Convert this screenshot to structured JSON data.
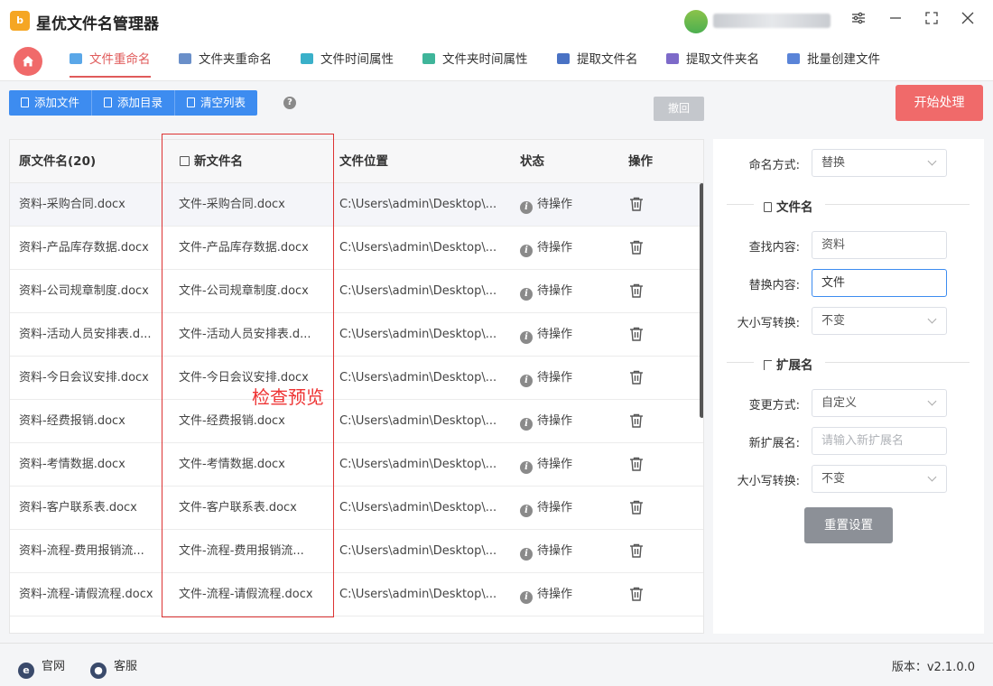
{
  "app": {
    "title": "星优文件名管理器",
    "logo_text": "b"
  },
  "window_controls": {
    "settings": "☰",
    "minimize": "—",
    "maximize": "⛶",
    "close": "✕"
  },
  "tabs": [
    {
      "label": "文件重命名",
      "active": true,
      "icon_color": "#5aa7e8"
    },
    {
      "label": "文件夹重命名",
      "active": false,
      "icon_color": "#6a8fc9"
    },
    {
      "label": "文件时间属性",
      "active": false,
      "icon_color": "#3ab0c9"
    },
    {
      "label": "文件夹时间属性",
      "active": false,
      "icon_color": "#3fb59a"
    },
    {
      "label": "提取文件名",
      "active": false,
      "icon_color": "#4a72c4"
    },
    {
      "label": "提取文件夹名",
      "active": false,
      "icon_color": "#7d6ac9"
    },
    {
      "label": "批量创建文件",
      "active": false,
      "icon_color": "#5a84d8"
    }
  ],
  "toolbar": {
    "add_file": "添加文件",
    "add_dir": "添加目录",
    "clear_list": "清空列表",
    "help": "?",
    "undo": "撤回",
    "start": "开始处理"
  },
  "table": {
    "headers": {
      "original": "原文件名(20)",
      "new": "新文件名",
      "location": "文件位置",
      "status": "状态",
      "action": "操作"
    },
    "rows": [
      {
        "original": "资料-采购合同.docx",
        "new": "文件-采购合同.docx",
        "location": "C:\\Users\\admin\\Desktop\\...",
        "status": "待操作"
      },
      {
        "original": "资料-产品库存数据.docx",
        "new": "文件-产品库存数据.docx",
        "location": "C:\\Users\\admin\\Desktop\\...",
        "status": "待操作"
      },
      {
        "original": "资料-公司规章制度.docx",
        "new": "文件-公司规章制度.docx",
        "location": "C:\\Users\\admin\\Desktop\\...",
        "status": "待操作"
      },
      {
        "original": "资料-活动人员安排表.d...",
        "new": "文件-活动人员安排表.d...",
        "location": "C:\\Users\\admin\\Desktop\\...",
        "status": "待操作"
      },
      {
        "original": "资料-今日会议安排.docx",
        "new": "文件-今日会议安排.docx",
        "location": "C:\\Users\\admin\\Desktop\\...",
        "status": "待操作"
      },
      {
        "original": "资料-经费报销.docx",
        "new": "文件-经费报销.docx",
        "location": "C:\\Users\\admin\\Desktop\\...",
        "status": "待操作"
      },
      {
        "original": "资料-考情数据.docx",
        "new": "文件-考情数据.docx",
        "location": "C:\\Users\\admin\\Desktop\\...",
        "status": "待操作"
      },
      {
        "original": "资料-客户联系表.docx",
        "new": "文件-客户联系表.docx",
        "location": "C:\\Users\\admin\\Desktop\\...",
        "status": "待操作"
      },
      {
        "original": "资料-流程-费用报销流...",
        "new": "文件-流程-费用报销流...",
        "location": "C:\\Users\\admin\\Desktop\\...",
        "status": "待操作"
      },
      {
        "original": "资料-流程-请假流程.docx",
        "new": "文件-流程-请假流程.docx",
        "location": "C:\\Users\\admin\\Desktop\\...",
        "status": "待操作"
      }
    ]
  },
  "annotation": {
    "label": "检查预览",
    "color": "#e33333"
  },
  "settings": {
    "naming_mode_label": "命名方式:",
    "naming_mode_value": "替换",
    "filename_section": "文件名",
    "find_label": "查找内容:",
    "find_value": "资料",
    "replace_label": "替换内容:",
    "replace_value": "文件",
    "case_label": "大小写转换:",
    "case_value": "不变",
    "ext_section": "扩展名",
    "change_mode_label": "变更方式:",
    "change_mode_value": "自定义",
    "new_ext_label": "新扩展名:",
    "new_ext_placeholder": "请输入新扩展名",
    "ext_case_label": "大小写转换:",
    "ext_case_value": "不变",
    "reset": "重置设置"
  },
  "footer": {
    "website": "官网",
    "support": "客服",
    "version": "版本：v2.1.0.0"
  },
  "colors": {
    "accent": "#e05b5b",
    "primary_blue": "#3d8cf0",
    "start_button": "#f06a6a"
  }
}
